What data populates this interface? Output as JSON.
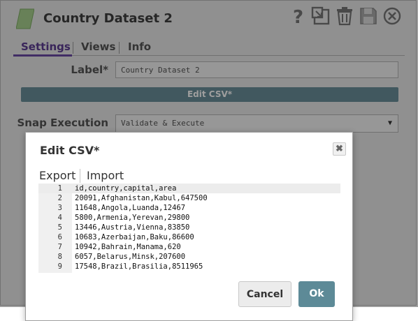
{
  "window": {
    "title": "Country Dataset 2",
    "tabs": [
      {
        "label": "Settings",
        "active": true
      },
      {
        "label": "Views",
        "active": false
      },
      {
        "label": "Info",
        "active": false
      }
    ],
    "toolbar_icons": [
      "help-icon",
      "export-icon",
      "delete-icon",
      "save-icon",
      "close-icon"
    ]
  },
  "settings": {
    "label_field": {
      "label": "Label*",
      "value": "Country Dataset 2"
    },
    "edit_csv_button": "Edit CSV*",
    "snap_execution": {
      "label": "Snap Execution",
      "value": "Validate & Execute"
    }
  },
  "modal": {
    "title": "Edit CSV*",
    "menu": {
      "export": "Export",
      "import": "Import"
    },
    "lines": [
      {
        "num": "1",
        "text": "id,country,capital,area"
      },
      {
        "num": "2",
        "text": "20091,Afghanistan,Kabul,647500"
      },
      {
        "num": "3",
        "text": "11648,Angola,Luanda,12467"
      },
      {
        "num": "4",
        "text": "5800,Armenia,Yerevan,29800"
      },
      {
        "num": "5",
        "text": "13446,Austria,Vienna,83850"
      },
      {
        "num": "6",
        "text": "10683,Azerbaijan,Baku,86600"
      },
      {
        "num": "7",
        "text": "10942,Bahrain,Manama,620"
      },
      {
        "num": "8",
        "text": "6057,Belarus,Minsk,207600"
      },
      {
        "num": "9",
        "text": "17548,Brazil,Brasilia,8511965"
      }
    ],
    "cancel_label": "Cancel",
    "ok_label": "Ok"
  },
  "colors": {
    "accent_tab": "#6a4aa3",
    "primary_button": "#5d8a97"
  }
}
